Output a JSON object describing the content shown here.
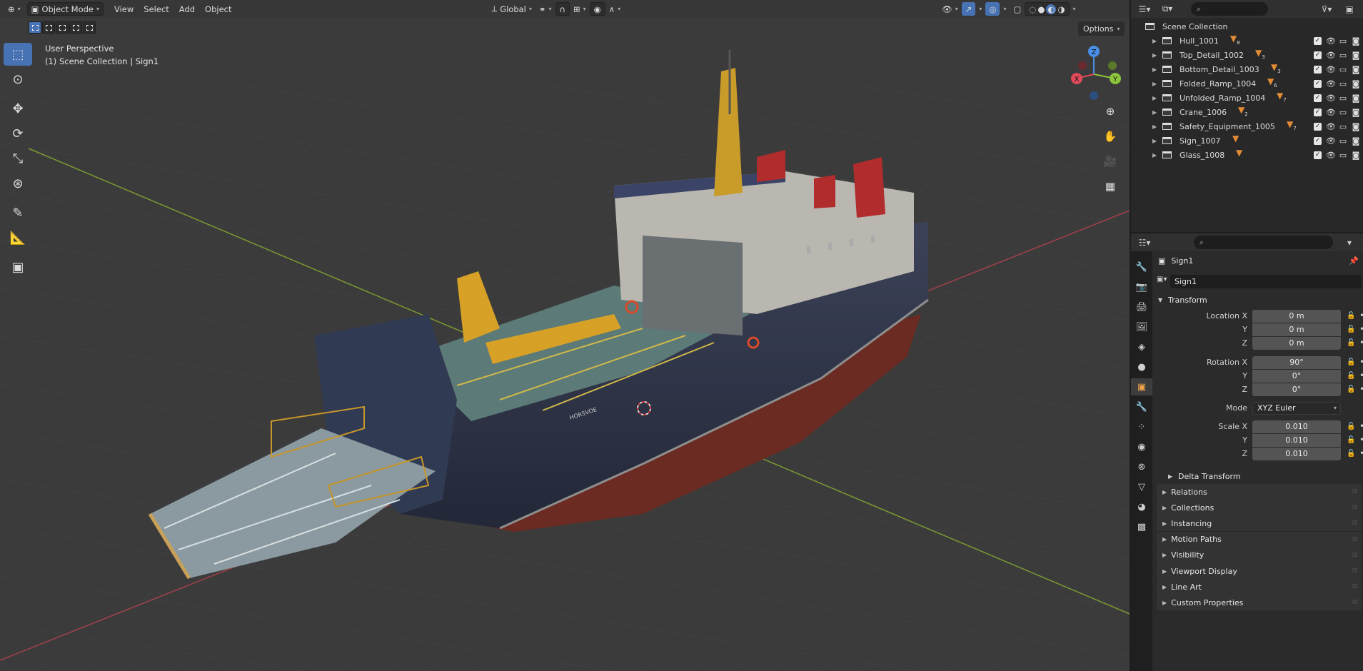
{
  "header": {
    "mode": "Object Mode",
    "menus": [
      "View",
      "Select",
      "Add",
      "Object"
    ],
    "orientation": "Global"
  },
  "viewport": {
    "perspective_label": "User Perspective",
    "context_label": "(1) Scene Collection | Sign1",
    "options_label": "Options",
    "gizmo": {
      "x": "X",
      "y": "Y",
      "z": "Z"
    },
    "hull_text": "HORSVOE"
  },
  "toolbar": {
    "tools": [
      "select-box",
      "cursor",
      "move",
      "rotate",
      "scale",
      "transform",
      "annotate",
      "measure",
      "add-cube"
    ]
  },
  "outliner": {
    "root": "Scene Collection",
    "items": [
      {
        "name": "Hull_1001",
        "badge": "8"
      },
      {
        "name": "Top_Detail_1002",
        "badge": "3"
      },
      {
        "name": "Bottom_Detail_1003",
        "badge": "3"
      },
      {
        "name": "Folded_Ramp_1004",
        "badge": "6"
      },
      {
        "name": "Unfolded_Ramp_1004",
        "badge": "7"
      },
      {
        "name": "Crane_1006",
        "badge": "2"
      },
      {
        "name": "Safety_Equipment_1005",
        "badge": "7"
      },
      {
        "name": "Sign_1007",
        "badge": ""
      },
      {
        "name": "Glass_1008",
        "badge": ""
      }
    ]
  },
  "properties": {
    "object_name": "Sign1",
    "name_field": "Sign1",
    "transform_label": "Transform",
    "location_label": "Location X",
    "location": {
      "x": "0 m",
      "y": "0 m",
      "z": "0 m"
    },
    "rotation_label": "Rotation X",
    "rotation": {
      "x": "90°",
      "y": "0°",
      "z": "0°"
    },
    "mode_label": "Mode",
    "mode_value": "XYZ Euler",
    "scale_label": "Scale X",
    "scale": {
      "x": "0.010",
      "y": "0.010",
      "z": "0.010"
    },
    "axis_y": "Y",
    "axis_z": "Z",
    "delta_transform": "Delta Transform",
    "panels": [
      "Relations",
      "Collections",
      "Instancing",
      "Motion Paths",
      "Visibility",
      "Viewport Display",
      "Line Art",
      "Custom Properties"
    ]
  },
  "colors": {
    "accent": "#4772b3",
    "object_orange": "#e38b35",
    "axis_x": "#e04a5a",
    "axis_y": "#8cc43c",
    "axis_z": "#4a8fe6"
  }
}
